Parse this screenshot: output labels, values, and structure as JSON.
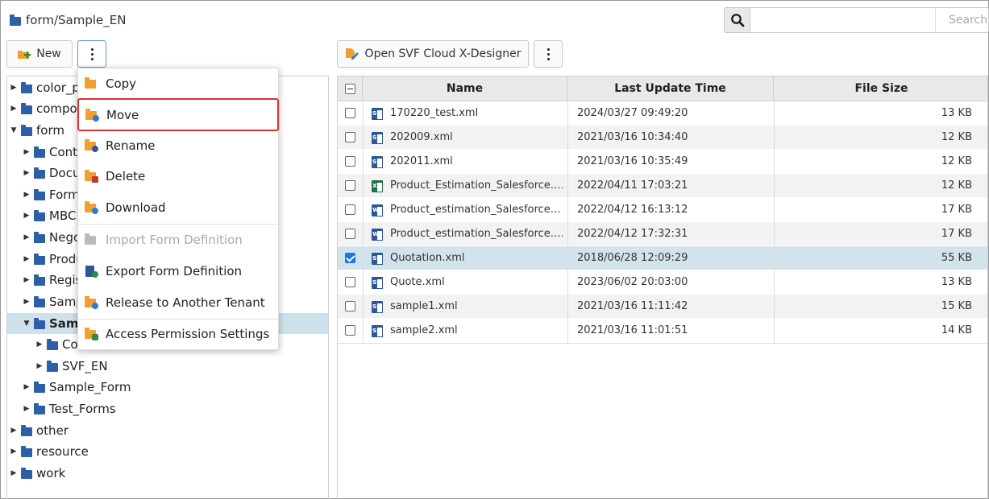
{
  "header": {
    "breadcrumb": "form/Sample_EN",
    "search_placeholder": "Search"
  },
  "toolbar": {
    "new_label": "New",
    "open_designer_label": "Open SVF Cloud X-Designer"
  },
  "tree": {
    "nodes": [
      {
        "label": "color_p",
        "state": "collapsed"
      },
      {
        "label": "compos",
        "state": "collapsed"
      },
      {
        "label": "form",
        "state": "expanded"
      },
      {
        "label": "Conta",
        "state": "collapsed"
      },
      {
        "label": "Docu",
        "state": "collapsed"
      },
      {
        "label": "Form",
        "state": "collapsed"
      },
      {
        "label": "MBC",
        "state": "collapsed"
      },
      {
        "label": "Nego",
        "state": "collapsed"
      },
      {
        "label": "Produ",
        "state": "collapsed"
      },
      {
        "label": "Regis",
        "state": "collapsed"
      },
      {
        "label": "Samp",
        "state": "collapsed"
      },
      {
        "label": "Samp",
        "state": "expanded",
        "selected": true
      },
      {
        "label": "Co",
        "state": "collapsed"
      },
      {
        "label": "SVF_EN",
        "state": "collapsed"
      },
      {
        "label": "Sample_Form",
        "state": "collapsed"
      },
      {
        "label": "Test_Forms",
        "state": "collapsed"
      },
      {
        "label": "other",
        "state": "collapsed"
      },
      {
        "label": "resource",
        "state": "collapsed"
      },
      {
        "label": "work",
        "state": "collapsed"
      }
    ]
  },
  "context_menu": {
    "items": [
      {
        "label": "Copy",
        "icon": "copy-icon",
        "enabled": true
      },
      {
        "label": "Move",
        "icon": "move-icon",
        "enabled": true,
        "highlighted": true
      },
      {
        "label": "Rename",
        "icon": "rename-icon",
        "enabled": true
      },
      {
        "label": "Delete",
        "icon": "delete-icon",
        "enabled": true
      },
      {
        "label": "Download",
        "icon": "download-icon",
        "enabled": true
      },
      {
        "label": "Import Form Definition",
        "icon": "import-icon",
        "enabled": false
      },
      {
        "label": "Export Form Definition",
        "icon": "export-icon",
        "enabled": true
      },
      {
        "label": "Release to Another Tenant",
        "icon": "release-icon",
        "enabled": true
      },
      {
        "label": "Access Permission Settings",
        "icon": "lock-icon",
        "enabled": true
      }
    ]
  },
  "grid": {
    "columns": [
      "Name",
      "Last Update Time",
      "File Size"
    ],
    "rows": [
      {
        "name": "170220_test.xml",
        "type": "xml",
        "updated": "2024/03/27 09:49:20",
        "size": "13 KB",
        "checked": false
      },
      {
        "name": "202009.xml",
        "type": "xml",
        "updated": "2021/03/16 10:34:40",
        "size": "12 KB",
        "checked": false
      },
      {
        "name": "202011.xml",
        "type": "xml",
        "updated": "2021/03/16 10:35:49",
        "size": "12 KB",
        "checked": false
      },
      {
        "name": "Product_Estimation_Salesforce.…",
        "type": "xls",
        "updated": "2022/04/11 17:03:21",
        "size": "12 KB",
        "checked": false
      },
      {
        "name": "Product_estimation_Salesforce…",
        "type": "doc",
        "updated": "2022/04/12 16:13:12",
        "size": "17 KB",
        "checked": false
      },
      {
        "name": "Product_estimation_Salesforce.…",
        "type": "doc",
        "updated": "2022/04/12 17:32:31",
        "size": "17 KB",
        "checked": false
      },
      {
        "name": "Quotation.xml",
        "type": "xml",
        "updated": "2018/06/28 12:09:29",
        "size": "55 KB",
        "checked": true
      },
      {
        "name": "Quote.xml",
        "type": "xml",
        "updated": "2023/06/02 20:03:00",
        "size": "13 KB",
        "checked": false
      },
      {
        "name": "sample1.xml",
        "type": "xml",
        "updated": "2021/03/16 11:11:42",
        "size": "15 KB",
        "checked": false
      },
      {
        "name": "sample2.xml",
        "type": "xml",
        "updated": "2021/03/16 11:01:51",
        "size": "14 KB",
        "checked": false
      }
    ]
  },
  "colors": {
    "folder": "#2d5ea8",
    "selection": "#d3e3ec",
    "menu_highlight_border": "#e03131",
    "checkbox_checked": "#1a73e8"
  }
}
